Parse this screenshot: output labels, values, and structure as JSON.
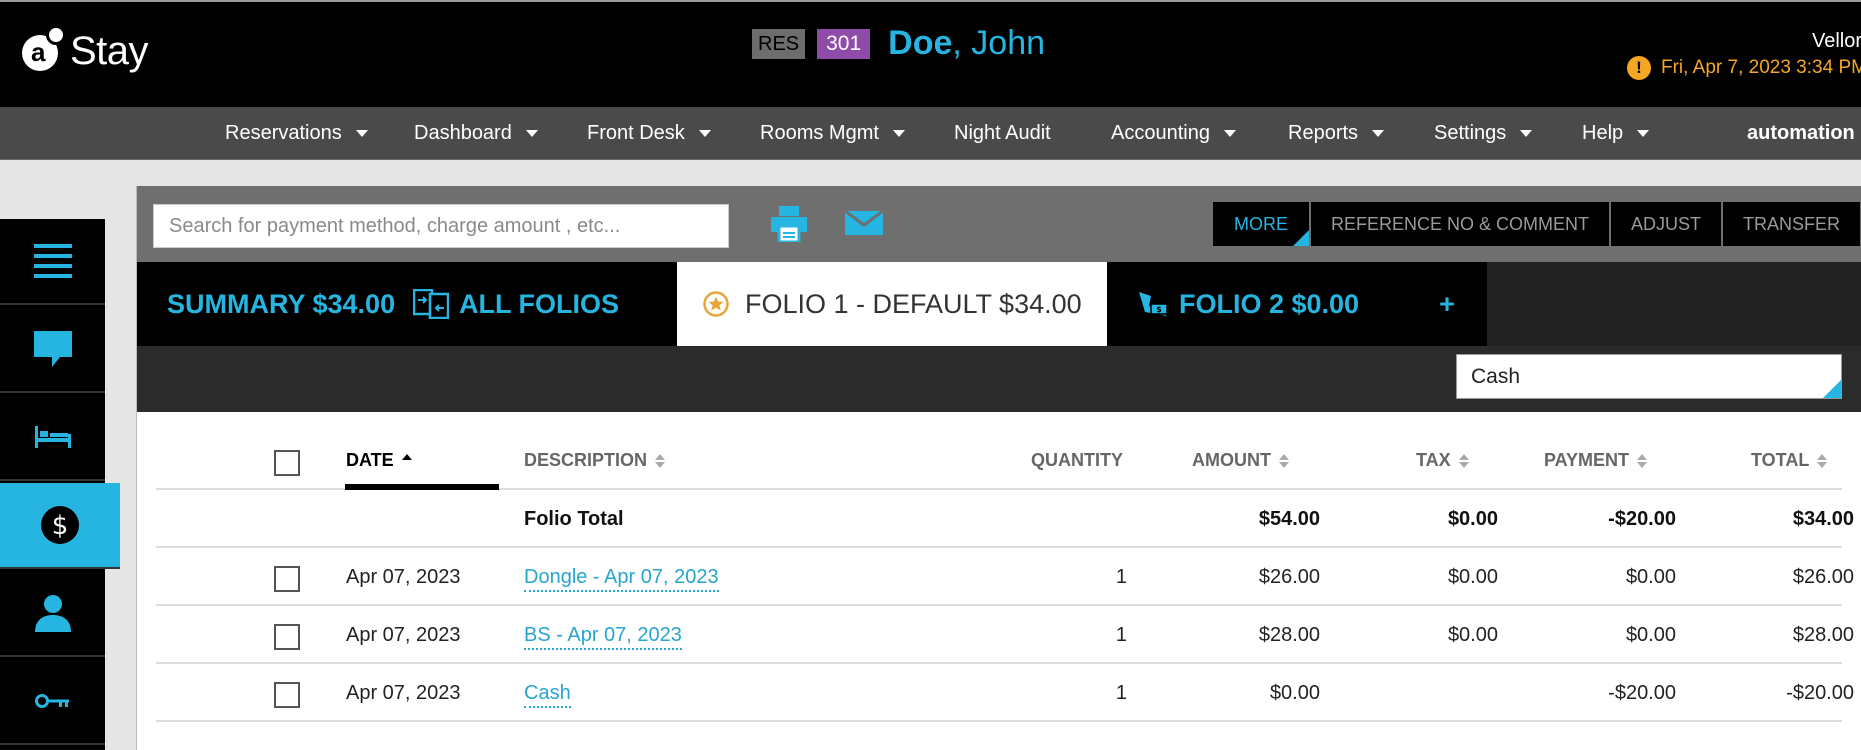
{
  "header": {
    "logo_text": "Stay",
    "logo_letter": "a",
    "res_badge": "RES",
    "room_badge": "301",
    "guest_last": "Doe",
    "guest_first": ", John",
    "user_short": "Vellor",
    "alert_icon": "!",
    "alert_text": "Fri, Apr 7, 2023 3:34 PM",
    "accent_color": "#26b5e0",
    "alert_color": "#f5a623"
  },
  "nav": {
    "items": [
      {
        "label": "Reservations",
        "dropdown": true
      },
      {
        "label": "Dashboard",
        "dropdown": true
      },
      {
        "label": "Front Desk",
        "dropdown": true
      },
      {
        "label": "Rooms Mgmt",
        "dropdown": true
      },
      {
        "label": "Night Audit",
        "dropdown": false
      },
      {
        "label": "Accounting",
        "dropdown": true
      },
      {
        "label": "Reports",
        "dropdown": true
      },
      {
        "label": "Settings",
        "dropdown": true
      },
      {
        "label": "Help",
        "dropdown": true
      }
    ],
    "user": "automation"
  },
  "sidebar": {
    "items": [
      {
        "icon": "list-icon"
      },
      {
        "icon": "chat-icon"
      },
      {
        "icon": "bed-icon"
      },
      {
        "icon": "dollar-icon",
        "active": true
      },
      {
        "icon": "person-icon"
      },
      {
        "icon": "key-icon"
      }
    ]
  },
  "toolbar": {
    "search_placeholder": "Search for payment method, charge amount , etc...",
    "actions": {
      "more": "MORE",
      "reference": "REFERENCE NO & COMMENT",
      "adjust": "ADJUST",
      "transfer": "TRANSFER"
    }
  },
  "tabs": {
    "summary": "SUMMARY $34.00",
    "all_folios": "ALL FOLIOS",
    "folio1": "FOLIO 1 - DEFAULT $34.00",
    "folio2": "FOLIO 2 $0.00",
    "add": "+"
  },
  "filter": {
    "selected": "Cash"
  },
  "table": {
    "headers": {
      "date": "DATE",
      "description": "DESCRIPTION",
      "quantity": "QUANTITY",
      "amount": "AMOUNT",
      "tax": "TAX",
      "payment": "PAYMENT",
      "total": "TOTAL"
    },
    "folio_total": {
      "label": "Folio Total",
      "amount": "$54.00",
      "tax": "$0.00",
      "payment": "-$20.00",
      "total": "$34.00"
    },
    "rows": [
      {
        "date": "Apr 07, 2023",
        "description": "Dongle - Apr 07, 2023",
        "quantity": "1",
        "amount": "$26.00",
        "tax": "$0.00",
        "payment": "$0.00",
        "total": "$26.00"
      },
      {
        "date": "Apr 07, 2023",
        "description": "BS - Apr 07, 2023",
        "quantity": "1",
        "amount": "$28.00",
        "tax": "$0.00",
        "payment": "$0.00",
        "total": "$28.00"
      },
      {
        "date": "Apr 07, 2023",
        "description": "Cash",
        "quantity": "1",
        "amount": "$0.00",
        "tax": "",
        "payment": "-$20.00",
        "total": "-$20.00"
      }
    ]
  }
}
